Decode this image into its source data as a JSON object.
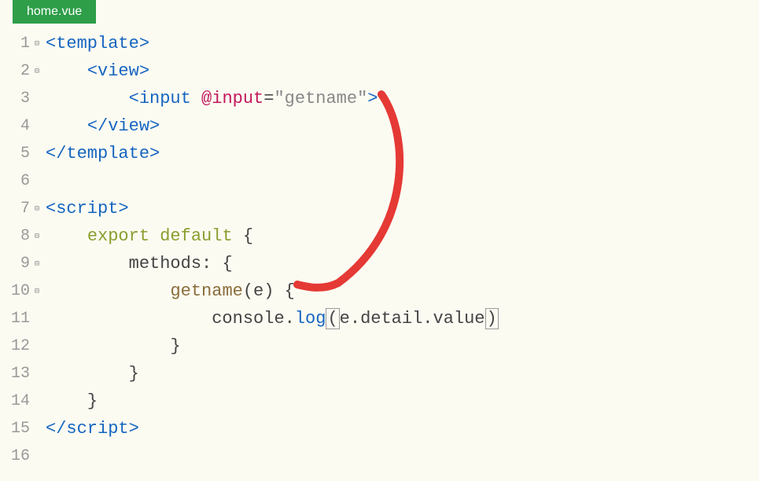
{
  "tab": {
    "filename": "home.vue"
  },
  "code": {
    "lines": [
      {
        "num": "1",
        "fold": "⊟"
      },
      {
        "num": "2",
        "fold": "⊟"
      },
      {
        "num": "3",
        "fold": ""
      },
      {
        "num": "4",
        "fold": ""
      },
      {
        "num": "5",
        "fold": ""
      },
      {
        "num": "6",
        "fold": ""
      },
      {
        "num": "7",
        "fold": "⊟"
      },
      {
        "num": "8",
        "fold": "⊟"
      },
      {
        "num": "9",
        "fold": "⊟"
      },
      {
        "num": "10",
        "fold": "⊟"
      },
      {
        "num": "11",
        "fold": ""
      },
      {
        "num": "12",
        "fold": ""
      },
      {
        "num": "13",
        "fold": ""
      },
      {
        "num": "14",
        "fold": ""
      },
      {
        "num": "15",
        "fold": ""
      },
      {
        "num": "16",
        "fold": ""
      }
    ],
    "tokens": {
      "template_open": "<template>",
      "view_open": "<view>",
      "input_open": "<input ",
      "at_input": "@input",
      "eq": "=",
      "quote": "\"",
      "getname_str": "getname",
      "input_close": ">",
      "view_close": "</view>",
      "template_close": "</template>",
      "script_open": "<script>",
      "export": "export",
      "default": "default",
      "brace_open": " {",
      "methods": "methods",
      "colon": ": {",
      "getname": "getname",
      "paren_e": "(e)",
      "brace": " {",
      "console": "console",
      "dot": ".",
      "log": "log",
      "paren_open": "(",
      "edetail": "e.detail.value",
      "paren_close": ")",
      "close_brace": "}",
      "script_close": "</script>"
    }
  }
}
